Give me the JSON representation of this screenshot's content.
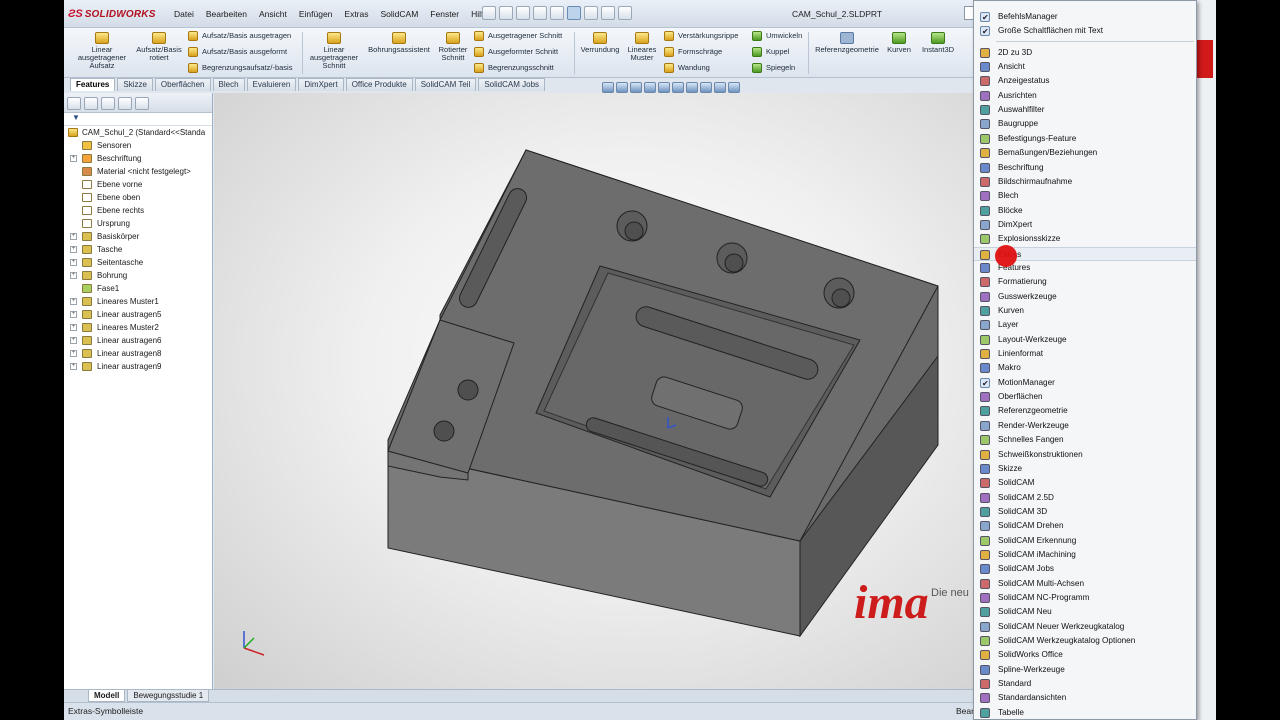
{
  "app": {
    "brand": "SOLIDWORKS",
    "doc_title": "CAM_Schul_2.SLDPRT"
  },
  "menus": [
    "Datei",
    "Bearbeiten",
    "Ansicht",
    "Einfügen",
    "Extras",
    "SolidCAM",
    "Fenster",
    "Hilfe"
  ],
  "command_manager": {
    "linear_extrude": "Linear ausgetragener Aufsatz",
    "revolve": "Aufsatz/Basis rotiert",
    "sweep_boss": "Aufsatz/Basis ausgetragen",
    "loft_boss": "Aufsatz/Basis ausgeformt",
    "boundary_boss": "Begrenzungsaufsatz/-basis",
    "linear_cut": "Linear ausgetragener Schnitt",
    "hole_wizard": "Bohrungsassistent",
    "revolve_cut": "Rotierter Schnitt",
    "swept_cut": "Ausgetragener Schnitt",
    "lofted_cut": "Ausgeformter Schnitt",
    "boundary_cut": "Begrenzungsschnitt",
    "fillet": "Verrundung",
    "linear_pattern": "Lineares Muster",
    "rib": "Verstärkungsrippe",
    "draft": "Formschräge",
    "shell": "Wandung",
    "wrap": "Umwickeln",
    "dome": "Kuppel",
    "mirror": "Spiegeln",
    "ref_geometry": "Referenzgeometrie",
    "curves": "Kurven",
    "instant3d": "Instant3D"
  },
  "tabs": [
    "Features",
    "Skizze",
    "Oberflächen",
    "Blech",
    "Evaluieren",
    "DimXpert",
    "Office Produkte",
    "SolidCAM Teil",
    "SolidCAM Jobs"
  ],
  "tree": {
    "root": "CAM_Schul_2  (Standard<<Standa",
    "items": [
      "Sensoren",
      "Beschriftung",
      "Material <nicht festgelegt>",
      "Ebene vorne",
      "Ebene oben",
      "Ebene rechts",
      "Ursprung",
      "Basiskörper",
      "Tasche",
      "Seitentasche",
      "Bohrung",
      "Fase1",
      "Lineares Muster1",
      "Linear austragen5",
      "Lineares Muster2",
      "Linear austragen6",
      "Linear austragen8",
      "Linear austragen9"
    ]
  },
  "bottom_tabs": [
    "Modell",
    "Bewegungsstudie 1"
  ],
  "status": {
    "left": "Extras-Symbolleiste",
    "right": "Bear"
  },
  "brand_overlay": {
    "tagline": "Die neu",
    "logo": "ima"
  },
  "context_menu": [
    {
      "label": "BefehlsManager",
      "checked": true
    },
    {
      "label": "Große Schaltflächen mit Text",
      "checked": true
    },
    {
      "label": "2D zu 3D"
    },
    {
      "label": "Ansicht"
    },
    {
      "label": "Anzeigestatus"
    },
    {
      "label": "Ausrichten"
    },
    {
      "label": "Auswahlfilter"
    },
    {
      "label": "Baugruppe"
    },
    {
      "label": "Befestigungs-Feature"
    },
    {
      "label": "Bemaßungen/Beziehungen"
    },
    {
      "label": "Beschriftung"
    },
    {
      "label": "Bildschirmaufnahme"
    },
    {
      "label": "Blech"
    },
    {
      "label": "Blöcke"
    },
    {
      "label": "DimXpert"
    },
    {
      "label": "Explosionsskizze"
    },
    {
      "label": "Extras",
      "hover": true
    },
    {
      "label": "Features"
    },
    {
      "label": "Formatierung"
    },
    {
      "label": "Gusswerkzeuge"
    },
    {
      "label": "Kurven"
    },
    {
      "label": "Layer"
    },
    {
      "label": "Layout-Werkzeuge"
    },
    {
      "label": "Linienformat"
    },
    {
      "label": "Makro"
    },
    {
      "label": "MotionManager",
      "checked": true
    },
    {
      "label": "Oberflächen"
    },
    {
      "label": "Referenzgeometrie"
    },
    {
      "label": "Render-Werkzeuge"
    },
    {
      "label": "Schnelles Fangen"
    },
    {
      "label": "Schweißkonstruktionen"
    },
    {
      "label": "Skizze"
    },
    {
      "label": "SolidCAM"
    },
    {
      "label": "SolidCAM 2.5D"
    },
    {
      "label": "SolidCAM 3D"
    },
    {
      "label": "SolidCAM Drehen"
    },
    {
      "label": "SolidCAM Erkennung"
    },
    {
      "label": "SolidCAM iMachining"
    },
    {
      "label": "SolidCAM Jobs"
    },
    {
      "label": "SolidCAM Multi-Achsen"
    },
    {
      "label": "SolidCAM NC-Programm"
    },
    {
      "label": "SolidCAM Neu"
    },
    {
      "label": "SolidCAM Neuer Werkzeugkatalog"
    },
    {
      "label": "SolidCAM Werkzeugkatalog Optionen"
    },
    {
      "label": "SolidWorks Office"
    },
    {
      "label": "Spline-Werkzeuge"
    },
    {
      "label": "Standard"
    },
    {
      "label": "Standardansichten"
    },
    {
      "label": "Tabelle"
    }
  ]
}
